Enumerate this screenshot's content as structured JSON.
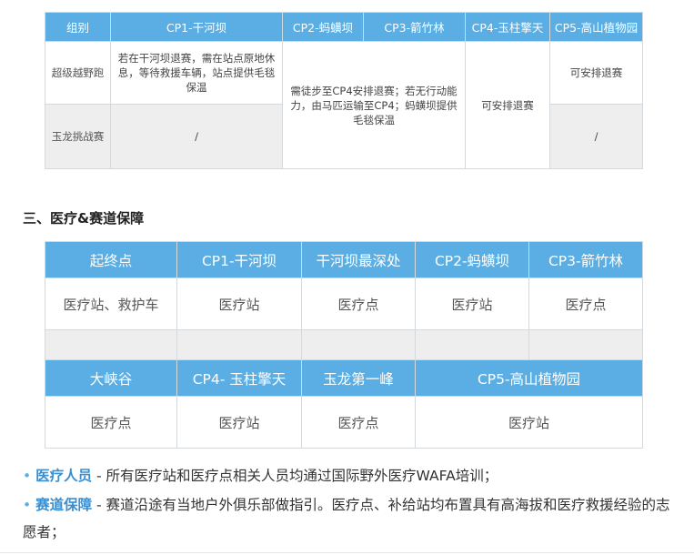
{
  "table1": {
    "headers": [
      "组别",
      "CP1-干河坝",
      "CP2-蚂蟥坝",
      "CP3-箭竹林",
      "CP4-玉柱擎天",
      "CP5-高山植物园"
    ],
    "rows": [
      {
        "group": "超级越野跑",
        "cp1": "若在干河坝退赛，需在站点原地休息，等待救援车辆，站点提供毛毯保温",
        "cp2_cp3": "需徒步至CP4安排退赛；若无行动能力，由马匹运输至CP4；蚂蟥坝提供毛毯保温",
        "cp4": "可安排退赛",
        "cp5": "可安排退赛"
      },
      {
        "group": "玉龙挑战赛",
        "cp1": "/",
        "cp5": "/"
      }
    ]
  },
  "section_title": "三、医疗&赛道保障",
  "table2": {
    "headers_top": [
      "起终点",
      "CP1-干河坝",
      "干河坝最深处",
      "CP2-蚂蟥坝",
      "CP3-箭竹林"
    ],
    "values_top": [
      "医疗站、救护车",
      "医疗站",
      "医疗点",
      "医疗站",
      "医疗点"
    ],
    "headers_bottom": [
      "大峡谷",
      "CP4- 玉柱擎天",
      "玉龙第一峰",
      "CP5-高山植物园"
    ],
    "values_bottom": [
      "医疗点",
      "医疗站",
      "医疗点",
      "医疗站"
    ]
  },
  "bullets": [
    {
      "term": "医疗人员",
      "text": " - 所有医疗站和医疗点相关人员均通过国际野外医疗WAFA培训；"
    },
    {
      "term": "赛道保障",
      "text": " - 赛道沿途有当地户外俱乐部做指引。医疗点、补给站均布置具有高海拔和医疗救援经验的志愿者；"
    }
  ],
  "colors": {
    "header_bg": "#5aaee3",
    "accent": "#3a8fd0",
    "grey_cell": "#eeeeee"
  }
}
